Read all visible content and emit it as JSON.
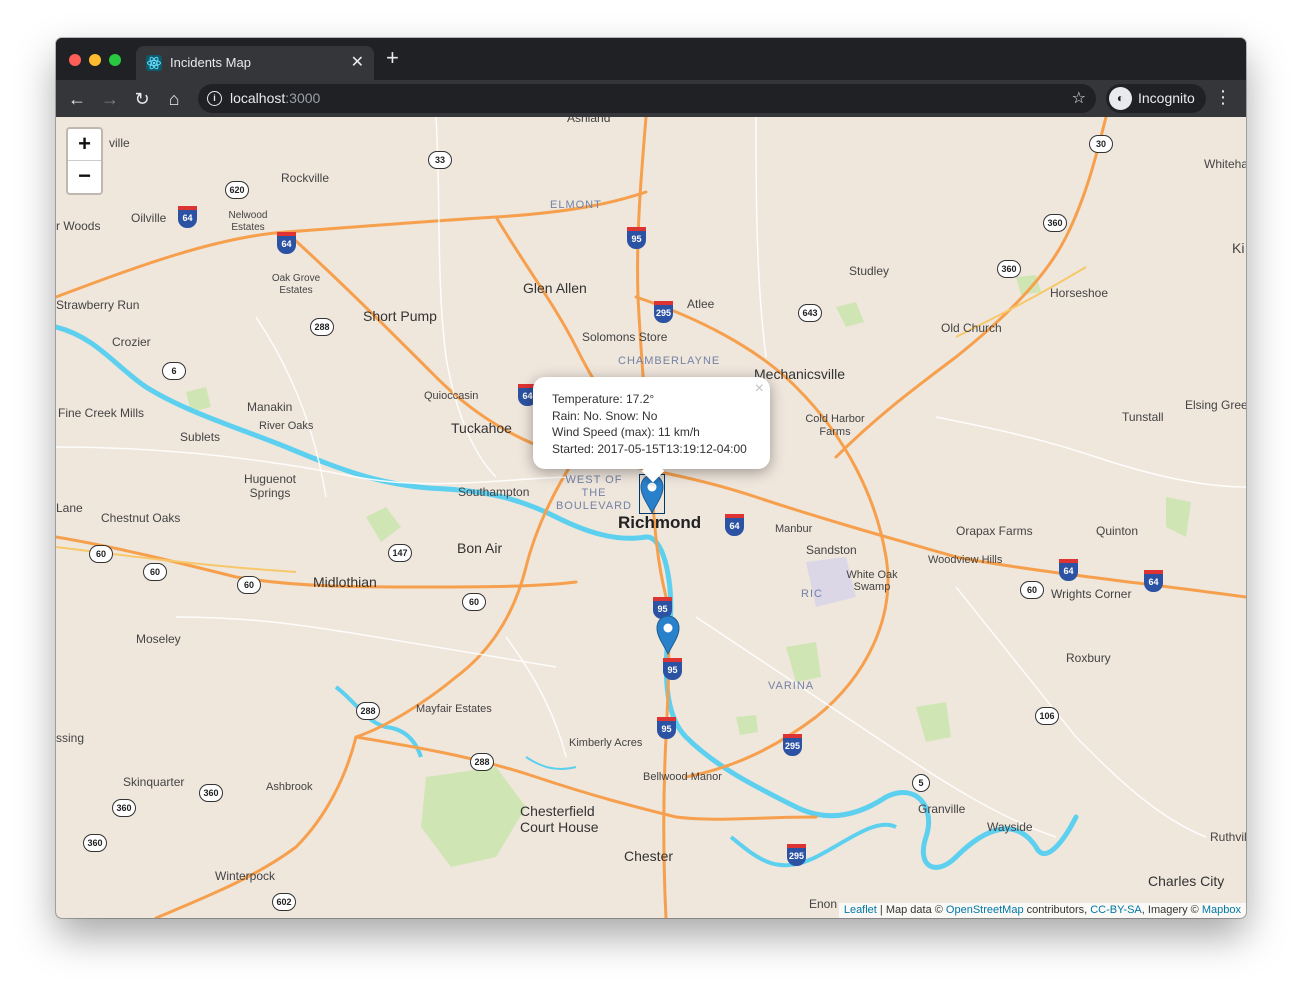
{
  "browser": {
    "tab_title": "Incidents Map",
    "url_host": "localhost",
    "url_port": ":3000",
    "profile_label": "Incognito"
  },
  "map": {
    "zoom_in": "+",
    "zoom_out": "−",
    "popup": {
      "close": "×",
      "line1": "Temperature: 17.2°",
      "line2": "Rain: No. Snow: No",
      "line3": "Wind Speed (max): 11 km/h",
      "line4": "Started: 2017-05-15T13:19:12-04:00"
    },
    "attribution": {
      "leaflet": "Leaflet",
      "sep1": " | Map data © ",
      "osm": "OpenStreetMap",
      "sep2": " contributors, ",
      "license": "CC-BY-SA",
      "sep3": ", Imagery © ",
      "mapbox": "Mapbox"
    },
    "place_labels": {
      "ashland": "Ashland",
      "rockville": "Rockville",
      "oilville": "Oilville",
      "woods": "r Woods",
      "nelwood": "Nelwood Estates",
      "elmont": "ELMONT",
      "studley": "Studley",
      "horseshoe": "Horseshoe",
      "whiteha": "Whiteha",
      "oakgrove": "Oak Grove Estates",
      "strawberry": "Strawberry Run",
      "glenallen": "Glen Allen",
      "atlee": "Atlee",
      "shortpump": "Short Pump",
      "solomons": "Solomons Store",
      "oldchurch": "Old Church",
      "crozier": "Crozier",
      "chamberlayne": "CHAMBERLAYNE",
      "mechanicsville": "Mechanicsville",
      "quioccasin": "Quioccasin",
      "manakin": "Manakin",
      "finecreek": "Fine Creek Mills",
      "riveroaks": "River Oaks",
      "tuckahoe": "Tuckahoe",
      "coldharbor": "Cold Harbor Farms",
      "tunstall": "Tunstall",
      "elsinggreen": "Elsing Gree",
      "sublets": "Sublets",
      "huguenot": "Huguenot Springs",
      "southampton": "Southampton",
      "westboulevard": "WEST OF THE BOULEVARD",
      "richmond": "Richmond",
      "manbur": "Manbur",
      "orapax": "Orapax Farms",
      "quinton": "Quinton",
      "lane": "Lane",
      "chestnutoaks": "Chestnut Oaks",
      "bonair": "Bon Air",
      "sandston": "Sandston",
      "woodviewhills": "Woodview Hills",
      "whiteoak": "White Oak Swamp",
      "ric": "RIC",
      "wrightscorner": "Wrights Corner",
      "midlothian": "Midlothian",
      "moseley": "Moseley",
      "roxbury": "Roxbury",
      "varina": "VARINA",
      "mayfair": "Mayfair Estates",
      "ssing": "ssing",
      "kimberly": "Kimberly Acres",
      "bellwood": "Bellwood Manor",
      "skinquarter": "Skinquarter",
      "ashbrook": "Ashbrook",
      "chesterfield1": "Chesterfield",
      "chesterfield2": "Court House",
      "granville": "Granville",
      "wayside": "Wayside",
      "ruthvil": "Ruthvil",
      "chester": "Chester",
      "charlescity": "Charles City",
      "winterpock": "Winterpock",
      "enon": "Enon",
      "kin": "Ki",
      "ille": "ville"
    },
    "route_shields": {
      "s33": "33",
      "s620": "620",
      "s30": "30",
      "s360a": "360",
      "s360b": "360",
      "s288a": "288",
      "s6": "6",
      "s643": "643",
      "s147": "147",
      "s60a": "60",
      "s60b": "60",
      "s60c": "60",
      "s60d": "60",
      "s60e": "60",
      "s288b": "288",
      "s288c": "288",
      "s106": "106",
      "s5": "5",
      "s360c": "360",
      "s360d": "360",
      "s360e": "360",
      "s602": "602",
      "i64a": "64",
      "i64b": "64",
      "i95a": "95",
      "i295a": "295",
      "i64c": "64",
      "i64d": "64",
      "i64e": "64",
      "i64f": "64",
      "i95b": "95",
      "i95c": "95",
      "i95d": "95",
      "i295b": "295",
      "i295c": "295"
    },
    "marker_count": 2
  },
  "colors": {
    "map_bg": "#efe6dc",
    "water": "#5dd0f0",
    "major_road": "#f6a04d",
    "park": "#cfe6b4",
    "marker": "#2a81cb",
    "link": "#0078a8"
  }
}
